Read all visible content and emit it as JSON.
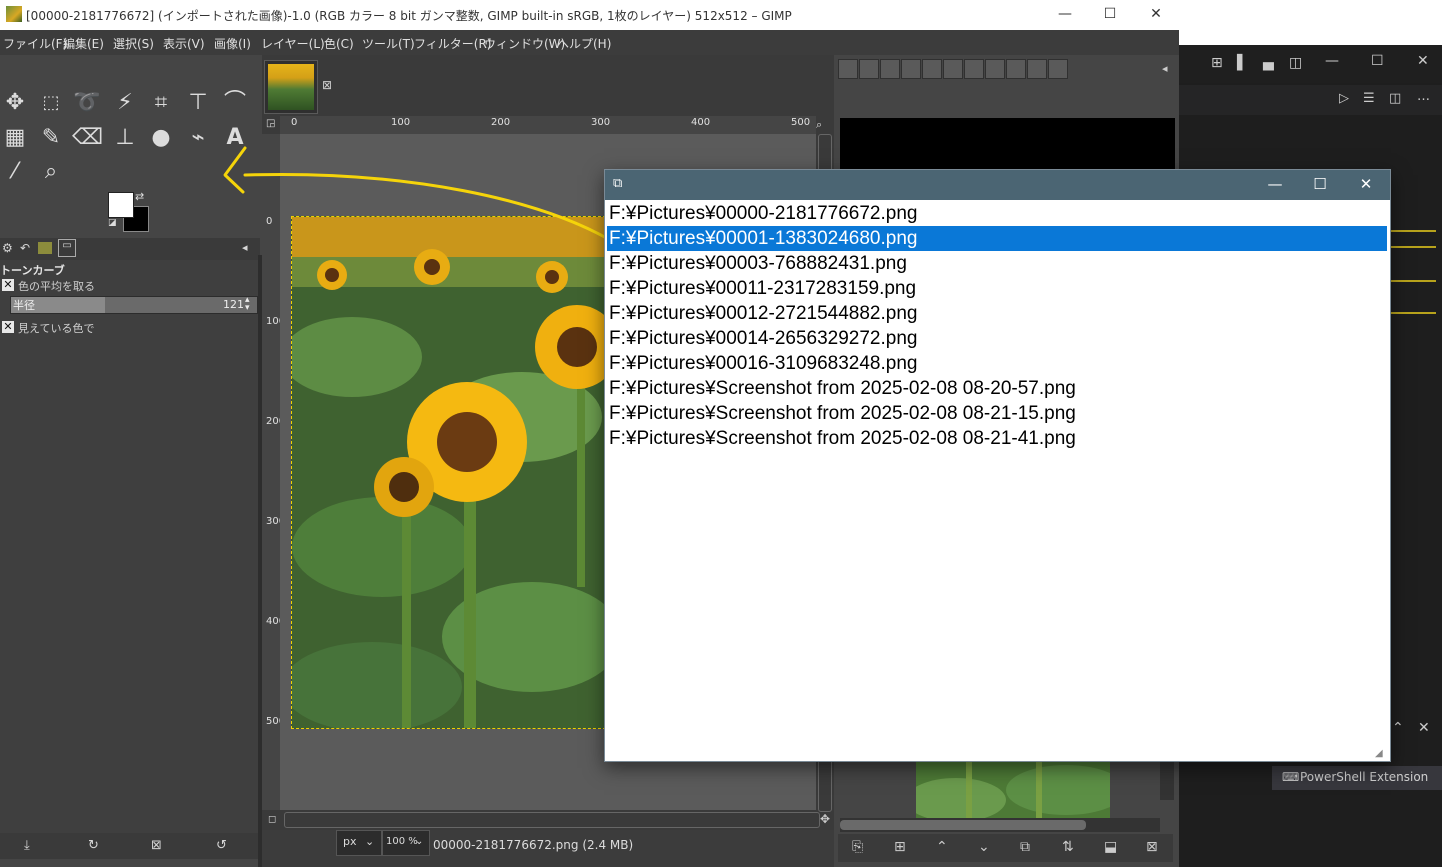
{
  "gimp": {
    "title": "[00000-2181776672] (インポートされた画像)-1.0 (RGB カラー 8 bit ガンマ整数, GIMP built-in sRGB, 1枚のレイヤー) 512x512 – GIMP",
    "menu": [
      "ファイル(F)",
      "編集(E)",
      "選択(S)",
      "表示(V)",
      "画像(I)",
      "レイヤー(L)",
      "色(C)",
      "ツール(T)",
      "フィルター(R)",
      "ウィンドウ(W)",
      "ヘルプ(H)"
    ],
    "tool_options": {
      "title": "トーンカーブ",
      "sample_average": "色の平均を取る",
      "radius_label": "半径",
      "radius_value": "121",
      "sample_merged": "見えている色で"
    },
    "ruler_top": [
      "0",
      "100",
      "200",
      "300",
      "400",
      "500"
    ],
    "ruler_left": [
      "0",
      "100",
      "200",
      "300",
      "400",
      "500"
    ],
    "status": {
      "unit": "px",
      "zoom": "100 %",
      "file_info": "00000-2181776672.png (2.4 MB)"
    }
  },
  "vscode": {
    "panel_item": "PowerShell Extension"
  },
  "dialog": {
    "selected_index": 1,
    "files": [
      "F:¥Pictures¥00000-2181776672.png",
      "F:¥Pictures¥00001-1383024680.png",
      "F:¥Pictures¥00003-768882431.png",
      "F:¥Pictures¥00011-2317283159.png",
      "F:¥Pictures¥00012-2721544882.png",
      "F:¥Pictures¥00014-2656329272.png",
      "F:¥Pictures¥00016-3109683248.png",
      "F:¥Pictures¥Screenshot from 2025-02-08 08-20-57.png",
      "F:¥Pictures¥Screenshot from 2025-02-08 08-21-15.png",
      "F:¥Pictures¥Screenshot from 2025-02-08 08-21-41.png"
    ]
  },
  "colors": {
    "selection": "#0a78d7",
    "dialog_titlebar": "#4b6573",
    "annotation": "#f5d40a"
  }
}
